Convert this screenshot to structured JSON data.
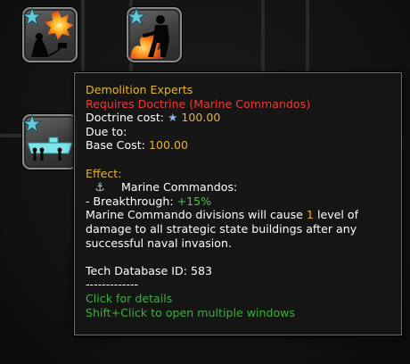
{
  "colors": {
    "title": "#e6b431",
    "requirement": "#ef3a34",
    "value_gold": "#e6b431",
    "value_green": "#4fc24f",
    "link_green": "#3fae3f",
    "text": "#ffffff"
  },
  "tech_icons": [
    {
      "name": "demolition-tech",
      "icon": "explosion-sabotage-icon"
    },
    {
      "name": "assault-tech",
      "icon": "flamethrower-soldier-icon"
    },
    {
      "name": "naval-landing-tech",
      "icon": "landing-craft-icon"
    }
  ],
  "tooltip": {
    "title": "Demolition Experts",
    "requires": "Requires Doctrine (Marine Commandos)",
    "doctrine_cost_label": "Doctrine cost:",
    "doctrine_cost_icon": "★",
    "doctrine_cost_value": "100.00",
    "due_to_label": "Due to:",
    "base_cost_label": "Base Cost:",
    "base_cost_value": "100.00",
    "effect_label": "Effect:",
    "effect_icon": "⚓",
    "effect_target": "Marine Commandos:",
    "effect_stat_label": "- Breakthrough:",
    "effect_stat_value": "+15%",
    "desc_part1": "Marine Commando divisions will cause ",
    "desc_number": "1",
    "desc_part2": " level of damage to all strategic state buildings after any successful naval invasion.",
    "db_id_label": "Tech Database ID: 583",
    "separator": "-------------",
    "click_hint": "Click for details",
    "shift_click_hint": "Shift+Click to open multiple windows"
  }
}
